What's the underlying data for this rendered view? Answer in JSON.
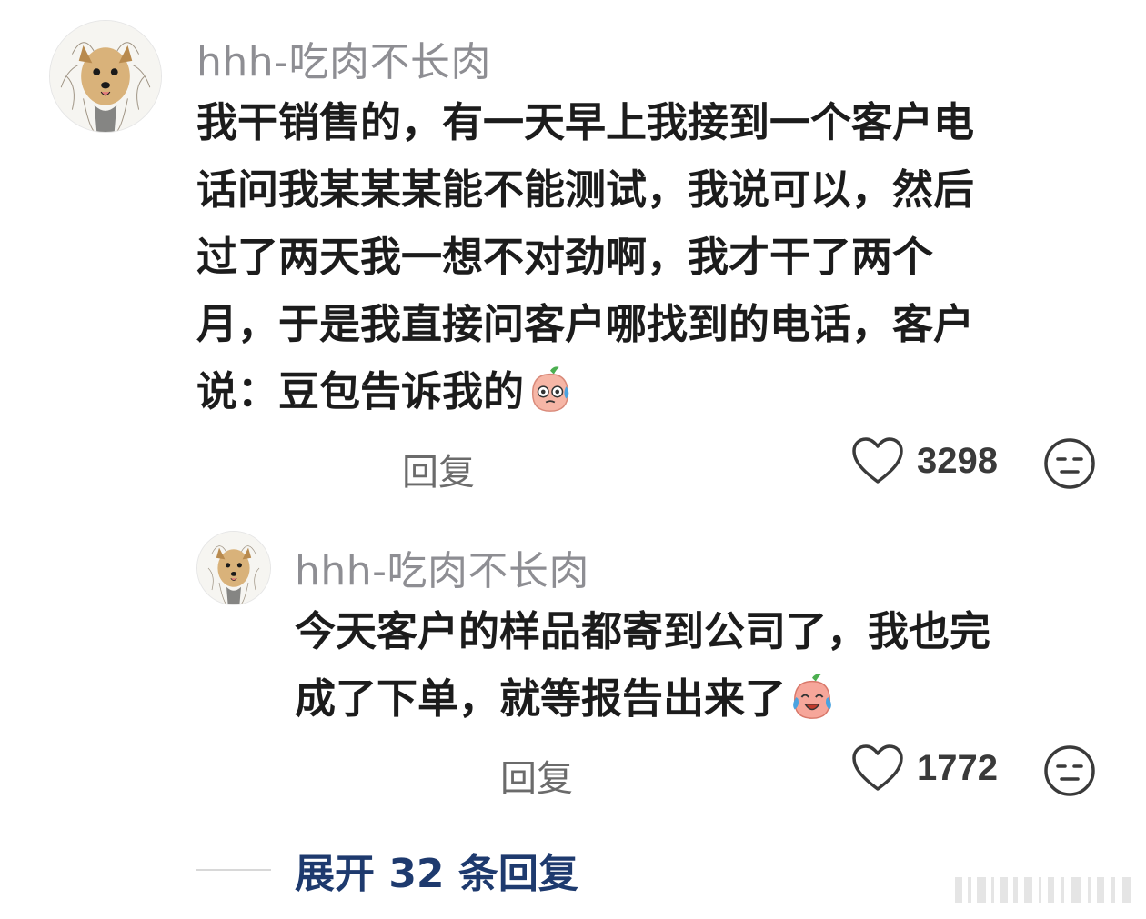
{
  "comment": {
    "avatar_icon": "yorkie-dog-avatar-icon",
    "username": "hhh-吃肉不长肉",
    "lines": [
      "我干销售的，有一天早上我接到一个客户电",
      "话问我某某某能不能测试，我说可以，然后",
      "过了两天我一想不对劲啊，我才干了两个",
      "月，于是我直接问客户哪找到的电话，客户",
      "说：豆包告诉我的"
    ],
    "emoji": "nervous-peach-emoji-icon",
    "reply_label": "回复",
    "like_count": "3298"
  },
  "reply": {
    "avatar_icon": "yorkie-dog-avatar-icon",
    "username": "hhh-吃肉不长肉",
    "lines": [
      "今天客户的样品都寄到公司了，我也完",
      "成了下单，就等报告出来了"
    ],
    "emoji": "crying-laughing-peach-emoji-icon",
    "reply_label": "回复",
    "like_count": "1772"
  },
  "expand": {
    "label": "展开 32 条回复"
  },
  "colors": {
    "username": "#8e8e93",
    "text": "#1c1c1c",
    "expand": "#1e3a6e",
    "icon": "#3a3a3a"
  }
}
